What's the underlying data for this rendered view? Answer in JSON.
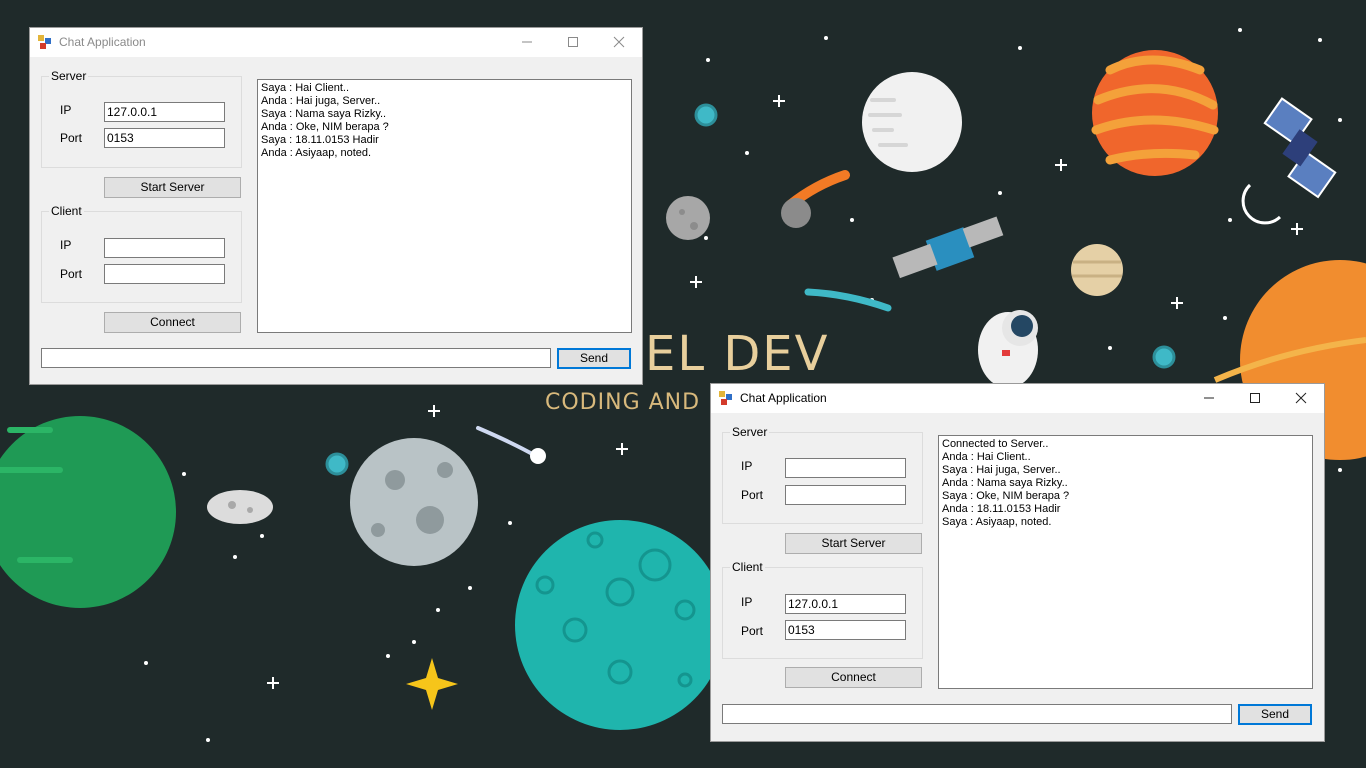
{
  "wallpaper": {
    "headline": "EL DEV",
    "tagline": "CODING AND L"
  },
  "windows": [
    {
      "title": "Chat Application",
      "server": {
        "group_label": "Server",
        "ip_label": "IP",
        "ip_value": "127.0.0.1",
        "port_label": "Port",
        "port_value": "0153",
        "button": "Start Server"
      },
      "client": {
        "group_label": "Client",
        "ip_label": "IP",
        "ip_value": "",
        "port_label": "Port",
        "port_value": "",
        "button": "Connect"
      },
      "messages": [
        "Saya : Hai Client..",
        "Anda : Hai juga, Server..",
        "Saya : Nama saya Rizky..",
        "Anda : Oke, NIM berapa ?",
        "Saya : 18.11.0153 Hadir",
        "Anda : Asiyaap, noted."
      ],
      "message_input": "",
      "send_label": "Send"
    },
    {
      "title": "Chat Application",
      "server": {
        "group_label": "Server",
        "ip_label": "IP",
        "ip_value": "",
        "port_label": "Port",
        "port_value": "",
        "button": "Start Server"
      },
      "client": {
        "group_label": "Client",
        "ip_label": "IP",
        "ip_value": "127.0.0.1",
        "port_label": "Port",
        "port_value": "0153",
        "button": "Connect"
      },
      "messages": [
        "Connected to Server..",
        "Anda : Hai Client..",
        "Saya : Hai juga, Server..",
        "Anda : Nama saya Rizky..",
        "Saya : Oke, NIM berapa ?",
        "Anda : 18.11.0153 Hadir",
        "Saya : Asiyaap, noted."
      ],
      "message_input": "",
      "send_label": "Send"
    }
  ],
  "colors": {
    "desktop_bg": "#1f2a2a",
    "accent": "#0078d7",
    "wallpaper_text": "#e8cf9c"
  },
  "icons": [
    "app-icon",
    "minimize-icon",
    "maximize-icon",
    "close-icon"
  ]
}
